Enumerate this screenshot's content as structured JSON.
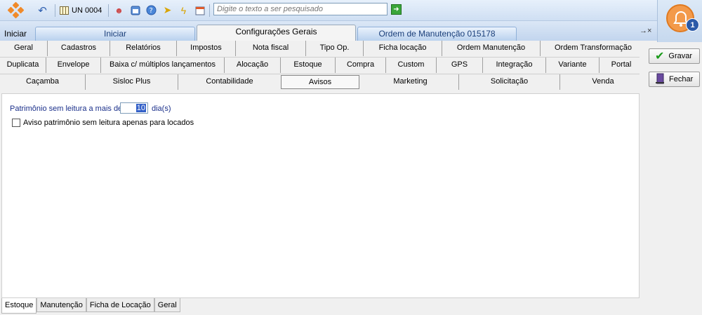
{
  "toolbar": {
    "un_label": "UN 0004",
    "search_placeholder": "Digite o texto a ser pesquisado"
  },
  "doc_tabs": {
    "start_label": "Iniciar",
    "tabs": [
      "Iniciar",
      "Configurações Gerais",
      "Ordem de Manutenção 015178"
    ],
    "active": "Configurações Gerais",
    "close_glyph": "→×"
  },
  "notifications": {
    "count": "1"
  },
  "actions": {
    "save_label": "Gravar",
    "close_label": "Fechar"
  },
  "settings_tabs": {
    "row1": [
      "Geral",
      "Cadastros",
      "Relatórios",
      "Impostos",
      "Nota fiscal",
      "Tipo Op.",
      "Ficha locação",
      "Ordem Manutenção",
      "Ordem Transformação"
    ],
    "row2": [
      "Duplicata",
      "Envelope",
      "Baixa c/ múltiplos lançamentos",
      "Alocação",
      "Estoque",
      "Compra",
      "Custom",
      "GPS",
      "Integração",
      "Variante",
      "Portal"
    ],
    "row3": [
      "Caçamba",
      "Sisloc Plus",
      "Contabilidade",
      "Avisos",
      "Marketing",
      "Solicitação",
      "Venda"
    ],
    "active": "Avisos"
  },
  "content": {
    "patrimonio_label": "Patrimônio sem leitura a mais de",
    "patrimonio_value": "10",
    "dias_label": "dia(s)",
    "checkbox_label": "Aviso patrimônio sem leitura apenas para locados",
    "checkbox_checked": false
  },
  "bottom_tabs": [
    "Estoque",
    "Manutenção",
    "Ficha de Locação",
    "Geral"
  ],
  "bottom_active": "Estoque"
}
